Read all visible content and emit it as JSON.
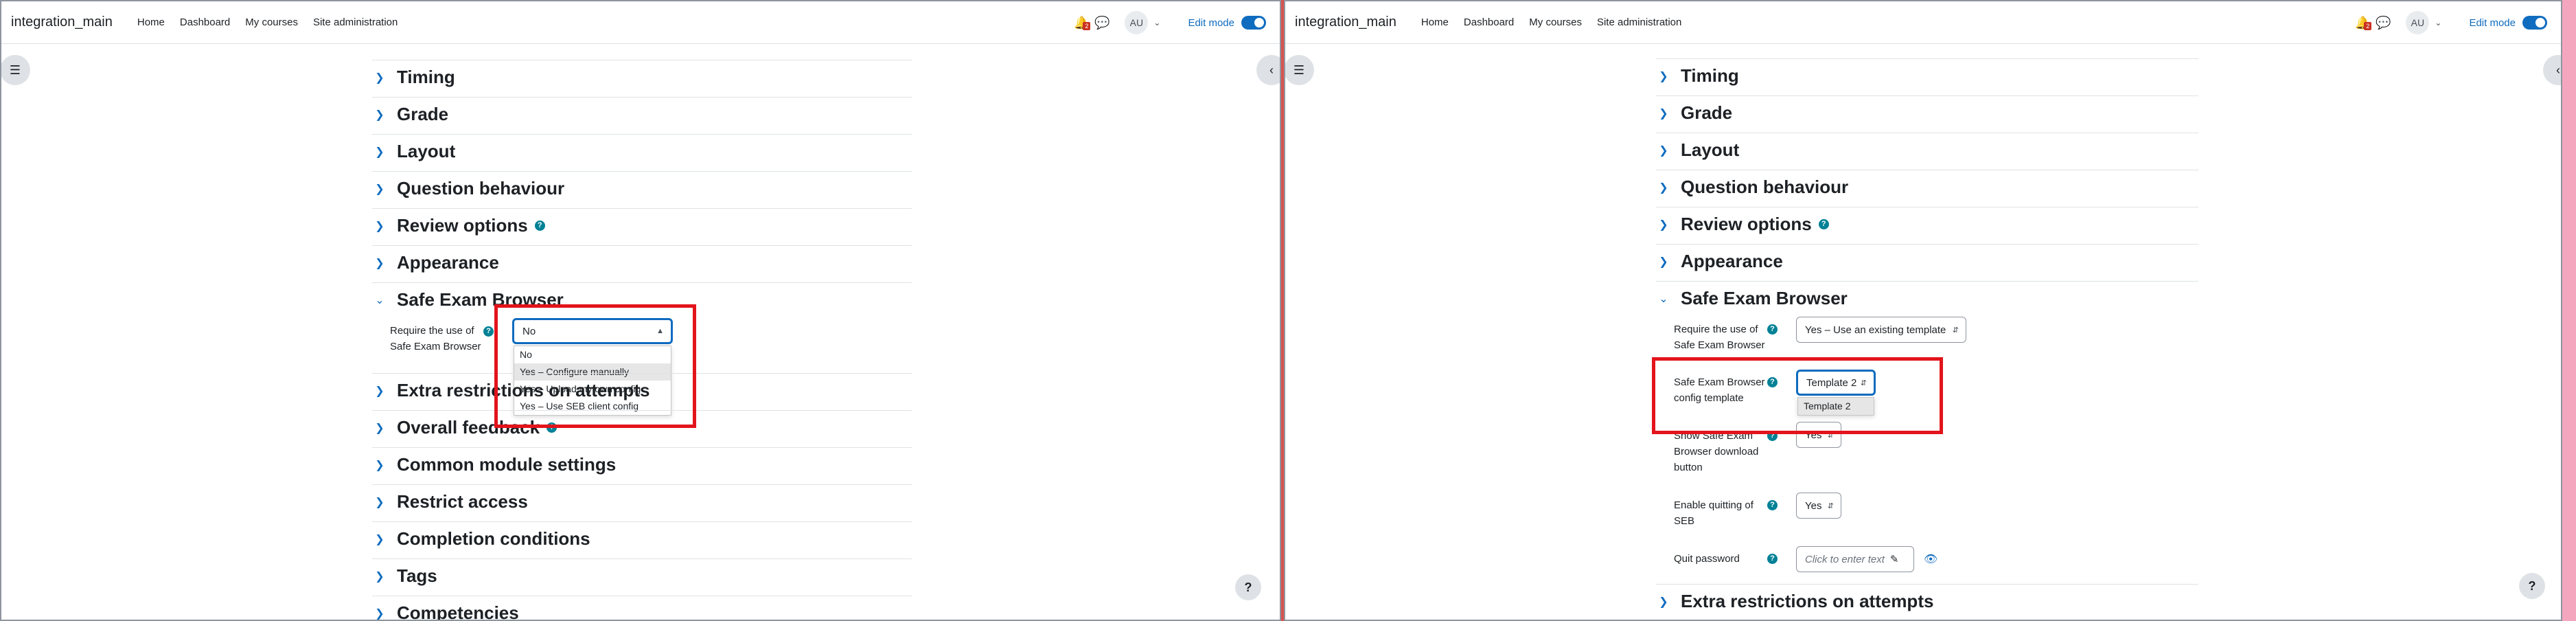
{
  "navbar": {
    "brand": "integration_main",
    "links": [
      "Home",
      "Dashboard",
      "My courses",
      "Site administration"
    ],
    "notification_count": "2",
    "avatar_initials": "AU",
    "edit_mode_label": "Edit mode"
  },
  "icons": {
    "bell": "bell-icon",
    "message": "chat-icon",
    "drawer": "list-icon",
    "collapse": "chevron-left-icon",
    "help": "question-icon",
    "eye": "eye-icon",
    "pencil": "pencil-icon"
  },
  "colors": {
    "accent": "#0f6cbf",
    "help_badge": "#008196",
    "highlight_box": "#e3141b"
  },
  "left": {
    "sections_top": [
      "Timing",
      "Grade",
      "Layout",
      "Question behaviour",
      "Review options",
      "Appearance",
      "Safe Exam Browser"
    ],
    "sections_bottom": [
      "Extra restrictions on attempts",
      "Overall feedback",
      "Common module settings",
      "Restrict access",
      "Completion conditions",
      "Tags",
      "Competencies"
    ],
    "seb_label_line1": "Require the use of",
    "seb_label_line2": "Safe Exam Browser",
    "seb_select_value": "No",
    "seb_options": [
      "No",
      "Yes – Configure manually",
      "Yes – Upload my own config",
      "Yes – Use SEB client config"
    ]
  },
  "right": {
    "sections": [
      "Timing",
      "Grade",
      "Layout",
      "Question behaviour",
      "Review options",
      "Appearance",
      "Safe Exam Browser"
    ],
    "require_label_line1": "Require the use of",
    "require_label_line2": "Safe Exam Browser",
    "require_value": "Yes – Use an existing template",
    "template_label_line1": "Safe Exam Browser",
    "template_label_line2": "config template",
    "template_value": "Template 2",
    "template_options": [
      "Template 2"
    ],
    "download_label_line1": "Show Safe Exam",
    "download_label_line2": "Browser download",
    "download_label_line3": "button",
    "download_value": "Yes",
    "quit_label_line1": "Enable quitting of",
    "quit_label_line2": "SEB",
    "quit_value": "Yes",
    "password_label": "Quit password",
    "password_placeholder": "Click to enter text",
    "next_section": "Extra restrictions on attempts"
  }
}
